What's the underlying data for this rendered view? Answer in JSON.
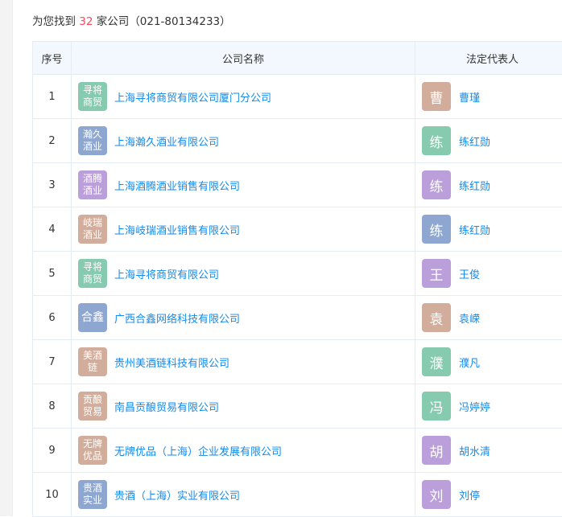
{
  "summary": {
    "prefix": "为您找到",
    "count": "32",
    "suffix": "家公司（021-80134233）"
  },
  "colors": {
    "green": "#86cbb0",
    "blue": "#8ea7d1",
    "purple": "#bb9fdb",
    "brown": "#d2ad9c",
    "link": "#128bed",
    "count": "#fd485e"
  },
  "table": {
    "headers": [
      "序号",
      "公司名称",
      "法定代表人"
    ],
    "rows": [
      {
        "index": "1",
        "logo": "寻将\n商贸",
        "logo_color": "green",
        "company": "上海寻将商贸有限公司厦门分公司",
        "avatar": "曹",
        "avatar_color": "brown",
        "person": "曹瑾"
      },
      {
        "index": "2",
        "logo": "瀚久\n酒业",
        "logo_color": "blue",
        "company": "上海瀚久酒业有限公司",
        "avatar": "练",
        "avatar_color": "green",
        "person": "练红勋"
      },
      {
        "index": "3",
        "logo": "酒腾\n酒业",
        "logo_color": "purple",
        "company": "上海酒腾酒业销售有限公司",
        "avatar": "练",
        "avatar_color": "purple",
        "person": "练红勋"
      },
      {
        "index": "4",
        "logo": "岐瑞\n酒业",
        "logo_color": "brown",
        "company": "上海岐瑞酒业销售有限公司",
        "avatar": "练",
        "avatar_color": "blue",
        "person": "练红勋"
      },
      {
        "index": "5",
        "logo": "寻将\n商贸",
        "logo_color": "green",
        "company": "上海寻将商贸有限公司",
        "avatar": "王",
        "avatar_color": "purple",
        "person": "王俊"
      },
      {
        "index": "6",
        "logo": "合鑫",
        "logo_color": "blue",
        "company": "广西合鑫网络科技有限公司",
        "avatar": "袁",
        "avatar_color": "brown",
        "person": "袁嵘"
      },
      {
        "index": "7",
        "logo": "美酒\n链",
        "logo_color": "brown",
        "company": "贵州美酒链科技有限公司",
        "avatar": "濮",
        "avatar_color": "green",
        "person": "濮凡"
      },
      {
        "index": "8",
        "logo": "贡酿\n贸易",
        "logo_color": "brown",
        "company": "南昌贡酿贸易有限公司",
        "avatar": "冯",
        "avatar_color": "green",
        "person": "冯婷婷"
      },
      {
        "index": "9",
        "logo": "无牌\n优品",
        "logo_color": "brown",
        "company": "无牌优品（上海）企业发展有限公司",
        "avatar": "胡",
        "avatar_color": "purple",
        "person": "胡水清"
      },
      {
        "index": "10",
        "logo": "贵酒\n实业",
        "logo_color": "blue",
        "company": "贵酒（上海）实业有限公司",
        "avatar": "刘",
        "avatar_color": "purple",
        "person": "刘停"
      }
    ]
  }
}
